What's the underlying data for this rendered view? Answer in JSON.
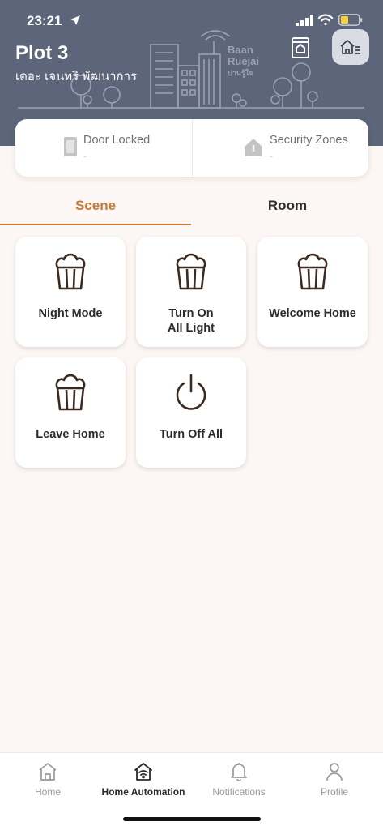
{
  "status_bar": {
    "time": "23:21"
  },
  "header": {
    "title": "Plot 3",
    "subtitle": "เดอะ เจนทริ พัฒนาการ",
    "brand_line1": "Baan",
    "brand_line2": "Ruejai",
    "brand_line3": "ปานรู้ใจ",
    "background_color": "#5C6579"
  },
  "status_card": {
    "door": {
      "label": "Door Locked",
      "value": "-",
      "icon": "door-icon"
    },
    "zones": {
      "label": "Security Zones",
      "value": "-",
      "icon": "shield-home-icon"
    }
  },
  "tabs": {
    "scene": "Scene",
    "room": "Room",
    "active": "scene",
    "accent_color": "#C87933"
  },
  "scenes": [
    {
      "label_line1": "Night Mode",
      "label_line2": "",
      "icon": "popcorn-icon"
    },
    {
      "label_line1": "Turn On",
      "label_line2": "All Light",
      "icon": "popcorn-icon"
    },
    {
      "label_line1": "Welcome Home",
      "label_line2": "",
      "icon": "popcorn-icon"
    },
    {
      "label_line1": "Leave Home",
      "label_line2": "",
      "icon": "popcorn-icon"
    },
    {
      "label_line1": "Turn Off All",
      "label_line2": "",
      "icon": "power-icon"
    }
  ],
  "bottom_nav": [
    {
      "label": "Home",
      "icon": "home-icon",
      "active": false
    },
    {
      "label": "Home Automation",
      "icon": "smart-home-icon",
      "active": true
    },
    {
      "label": "Notifications",
      "icon": "bell-icon",
      "active": false
    },
    {
      "label": "Profile",
      "icon": "user-icon",
      "active": false
    }
  ]
}
